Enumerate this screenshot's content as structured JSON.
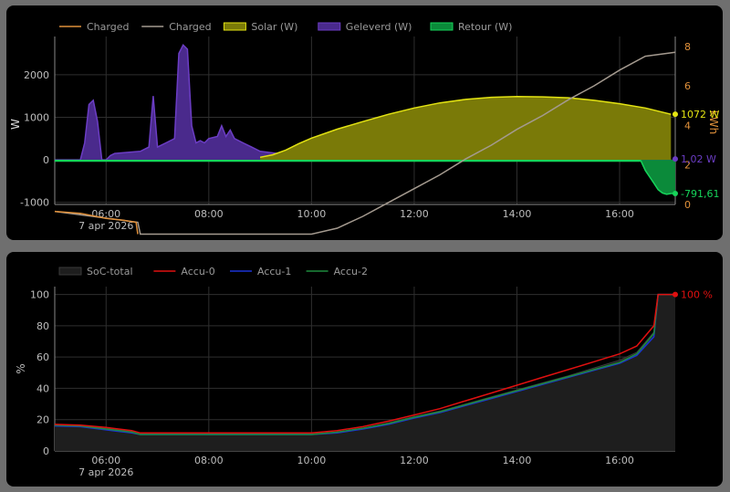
{
  "colors": {
    "panel_bg": "#000000",
    "grid": "#2f2f2f",
    "tick_text": "#bdbdbd",
    "solar": "#e3e312",
    "solar_fill": "#7a7a08",
    "geleverd": "#6b3dc4",
    "geleverd_fill": "#4a2a8c",
    "retour": "#16d45a",
    "retour_fill": "#0b8a3a",
    "charged_orange": "#e0903a",
    "charged_grey": "#a49a8f",
    "soc_fill": "#1e1e1e",
    "accu0": "#e01010",
    "accu1": "#1a33d6",
    "accu2": "#1d8a3d"
  },
  "chart_data": [
    {
      "type": "area",
      "legend": [
        "Charged",
        "Charged",
        "Solar (W)",
        "Geleverd (W)",
        "Retour (W)"
      ],
      "legend_placement": "top-left",
      "grid": true,
      "x_ticks": [
        "06:00",
        "08:00",
        "10:00",
        "12:00",
        "14:00",
        "16:00"
      ],
      "x_date": "7 apr 2026",
      "xlim": [
        "05:00",
        "17:05"
      ],
      "ylabel": "W",
      "ylim": [
        -1050,
        2900
      ],
      "y_ticks": [
        2000,
        1000,
        0,
        -1000
      ],
      "y2label": "kWh",
      "y2lim": [
        0,
        8.5
      ],
      "y2_ticks": [
        8,
        6,
        4,
        2,
        0
      ],
      "end_labels": {
        "solar": "1072 W",
        "geleverd": "1,02 W",
        "retour": "-791,61 W"
      },
      "series": [
        {
          "name": "Solar (W)",
          "key": "solar",
          "x": [
            "09:00",
            "09:15",
            "09:30",
            "09:45",
            "10:00",
            "10:30",
            "11:00",
            "11:30",
            "12:00",
            "12:30",
            "13:00",
            "13:30",
            "14:00",
            "14:30",
            "15:00",
            "15:30",
            "16:00",
            "16:30",
            "17:00"
          ],
          "y": [
            60,
            120,
            230,
            380,
            510,
            720,
            900,
            1070,
            1220,
            1340,
            1420,
            1470,
            1490,
            1480,
            1460,
            1400,
            1320,
            1220,
            1072
          ]
        },
        {
          "name": "Geleverd (W)",
          "key": "geleverd",
          "x": [
            "05:00",
            "05:30",
            "05:35",
            "05:40",
            "05:45",
            "05:50",
            "05:55",
            "06:00",
            "06:05",
            "06:10",
            "06:40",
            "06:50",
            "06:55",
            "07:00",
            "07:10",
            "07:20",
            "07:25",
            "07:30",
            "07:35",
            "07:40",
            "07:45",
            "07:50",
            "07:55",
            "08:00",
            "08:10",
            "08:15",
            "08:20",
            "08:25",
            "08:30",
            "08:40",
            "08:50",
            "09:00",
            "09:20",
            "09:40",
            "10:00",
            "17:00"
          ],
          "y": [
            0,
            0,
            400,
            1300,
            1400,
            900,
            0,
            0,
            100,
            150,
            200,
            300,
            1500,
            300,
            400,
            500,
            2500,
            2700,
            2600,
            800,
            400,
            450,
            400,
            500,
            550,
            800,
            550,
            700,
            500,
            400,
            300,
            200,
            150,
            0,
            0,
            1.02
          ]
        },
        {
          "name": "Retour (W)",
          "key": "retour",
          "x": [
            "05:00",
            "16:25",
            "16:30",
            "16:35",
            "16:40",
            "16:45",
            "16:50",
            "16:55",
            "17:00",
            "17:05"
          ],
          "y": [
            -30,
            -30,
            -250,
            -400,
            -550,
            -700,
            -780,
            -810,
            -792,
            -792
          ]
        },
        {
          "name": "Charged",
          "key": "charged_orange",
          "axis": "y2",
          "x": [
            "05:00",
            "05:30",
            "06:00",
            "06:20",
            "06:35",
            "06:37"
          ],
          "y": [
            -0.35,
            -0.45,
            -0.7,
            -0.8,
            -0.9,
            -1.5
          ]
        },
        {
          "name": "Charged",
          "key": "charged_grey",
          "axis": "y2",
          "x": [
            "05:00",
            "06:37",
            "06:40",
            "10:00",
            "10:30",
            "11:00",
            "11:30",
            "12:00",
            "12:30",
            "13:00",
            "13:30",
            "14:00",
            "14:30",
            "15:00",
            "15:30",
            "16:00",
            "16:30",
            "17:05"
          ],
          "y": [
            -0.35,
            -0.9,
            -1.5,
            -1.5,
            -1.2,
            -0.6,
            0.1,
            0.8,
            1.5,
            2.3,
            3.0,
            3.8,
            4.5,
            5.3,
            6.0,
            6.8,
            7.5,
            7.7
          ]
        }
      ]
    },
    {
      "type": "area",
      "legend": [
        "SoC-total",
        "Accu-0",
        "Accu-1",
        "Accu-2"
      ],
      "legend_placement": "top-left",
      "grid": true,
      "x_ticks": [
        "06:00",
        "08:00",
        "10:00",
        "12:00",
        "14:00",
        "16:00"
      ],
      "x_date": "7 apr 2026",
      "xlim": [
        "05:00",
        "17:05"
      ],
      "ylabel": "%",
      "ylim": [
        0,
        105
      ],
      "y_ticks": [
        100,
        80,
        60,
        40,
        20,
        0
      ],
      "end_label": "100 %",
      "series": [
        {
          "name": "SoC-total",
          "key": "soc",
          "x": [
            "05:00",
            "05:30",
            "06:00",
            "06:30",
            "06:40",
            "10:00",
            "10:30",
            "11:00",
            "11:30",
            "12:00",
            "12:30",
            "13:00",
            "13:30",
            "14:00",
            "14:30",
            "15:00",
            "15:30",
            "16:00",
            "16:20",
            "16:40",
            "16:45",
            "17:05"
          ],
          "y": [
            16.5,
            16,
            14.5,
            12.5,
            11,
            11,
            12,
            14.5,
            18,
            22,
            25.5,
            30,
            34.5,
            39,
            43.5,
            48,
            53,
            58,
            63,
            76,
            100,
            100
          ]
        },
        {
          "name": "Accu-0",
          "key": "accu0",
          "x": [
            "05:00",
            "05:30",
            "06:00",
            "06:30",
            "06:40",
            "10:00",
            "10:30",
            "11:00",
            "11:30",
            "12:00",
            "12:30",
            "13:00",
            "13:30",
            "14:00",
            "14:30",
            "15:00",
            "15:30",
            "16:00",
            "16:20",
            "16:40",
            "16:45",
            "17:05"
          ],
          "y": [
            17,
            16.5,
            15,
            13,
            11.5,
            11.5,
            13,
            15.5,
            19,
            23,
            27,
            32,
            37,
            42,
            47,
            52,
            57,
            62,
            67,
            80,
            100,
            100
          ]
        },
        {
          "name": "Accu-1",
          "key": "accu1",
          "x": [
            "05:00",
            "05:30",
            "06:00",
            "06:30",
            "06:40",
            "10:00",
            "10:30",
            "11:00",
            "11:30",
            "12:00",
            "12:30",
            "13:00",
            "13:30",
            "14:00",
            "14:30",
            "15:00",
            "15:30",
            "16:00",
            "16:20",
            "16:40",
            "16:45",
            "17:05"
          ],
          "y": [
            16,
            15.5,
            13.5,
            11.5,
            10.5,
            10.5,
            11.5,
            14,
            17,
            21,
            24.5,
            29,
            33.5,
            38,
            42.5,
            47,
            51.5,
            56,
            61,
            73,
            100,
            100
          ]
        },
        {
          "name": "Accu-2",
          "key": "accu2",
          "x": [
            "05:00",
            "05:30",
            "06:00",
            "06:30",
            "06:40",
            "10:00",
            "10:30",
            "11:00",
            "11:30",
            "12:00",
            "12:30",
            "13:00",
            "13:30",
            "14:00",
            "14:30",
            "15:00",
            "15:30",
            "16:00",
            "16:20",
            "16:40",
            "16:45",
            "17:05"
          ],
          "y": [
            16.5,
            16,
            14,
            12,
            10.5,
            10.5,
            12,
            14.5,
            17.5,
            21.5,
            25,
            29.5,
            34,
            38.5,
            43,
            47.5,
            52,
            56.5,
            62,
            75,
            100,
            100
          ]
        }
      ]
    }
  ]
}
